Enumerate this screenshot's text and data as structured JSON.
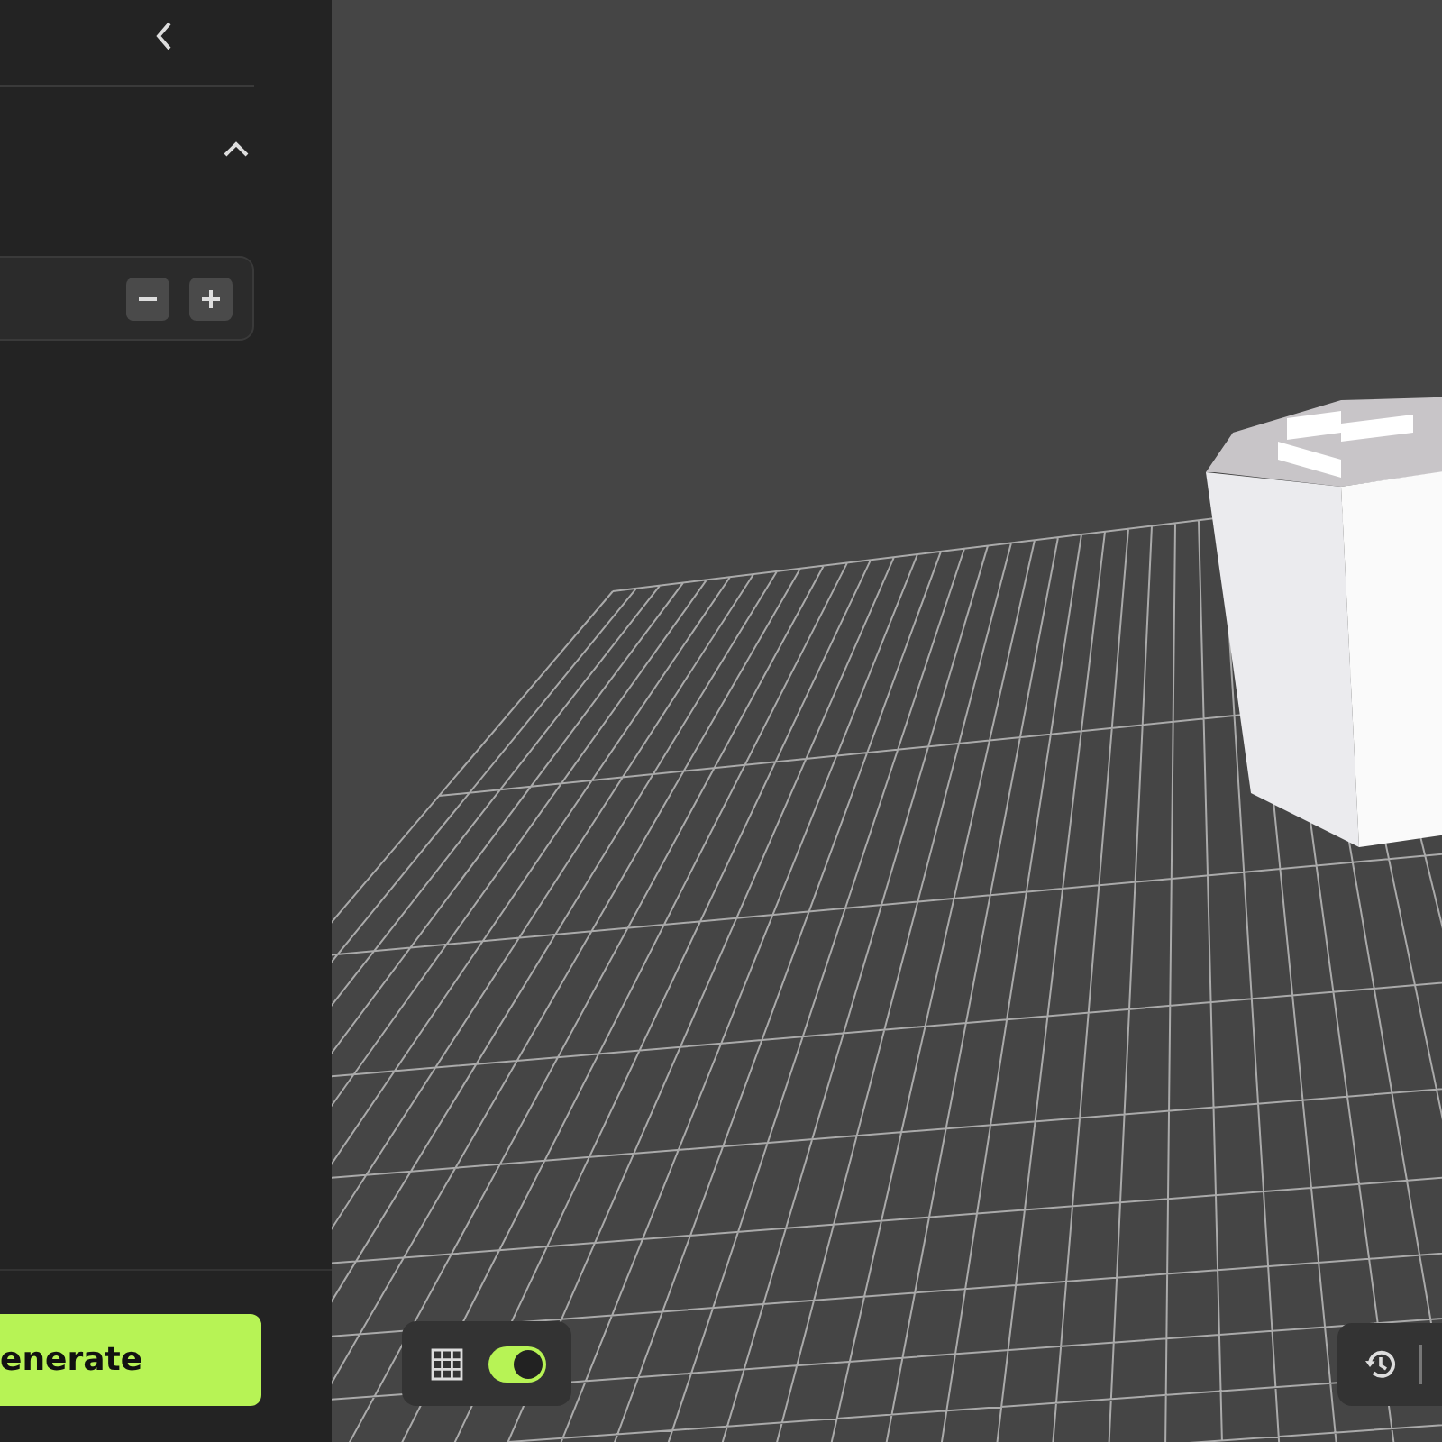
{
  "sidebar": {
    "generate_button": {
      "label": "enerate"
    }
  },
  "viewport": {
    "grid_toggle": {
      "on": true
    }
  }
}
